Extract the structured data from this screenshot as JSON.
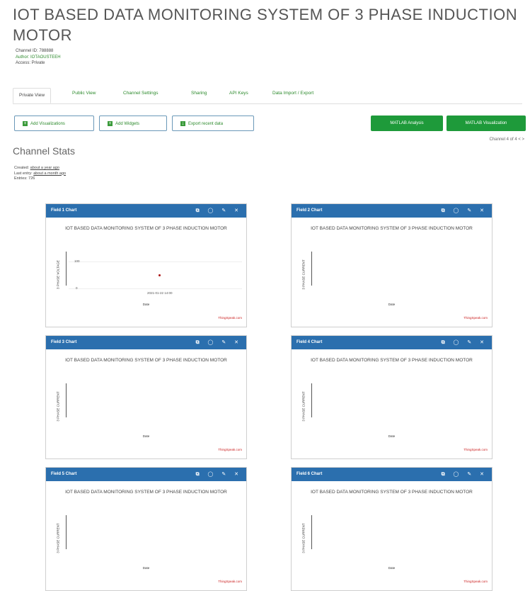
{
  "page": {
    "title": "IOT BASED DATA MONITORING SYSTEM OF 3 PHASE INDUCTION MOTOR"
  },
  "meta": {
    "channel_id": "Channel ID: 788888",
    "author": "Author: IOTAOUSTEEH",
    "access": "Access: Private"
  },
  "tabs": [
    {
      "label": "Private View"
    },
    {
      "label": "Public View"
    },
    {
      "label": "Channel Settings"
    },
    {
      "label": "Sharing"
    },
    {
      "label": "API Keys"
    },
    {
      "label": "Data Import / Export"
    }
  ],
  "toolbar": {
    "add_visualizations": "Add Visualizations",
    "add_widgets": "Add Widgets",
    "export_recent_data": "Export recent data",
    "matlab_analysis": "MATLAB Analysis",
    "matlab_visualization": "MATLAB Visualization"
  },
  "pager": "Channel 4 of 4 < >",
  "stats": {
    "title": "Channel Stats",
    "created": "Created:",
    "created_value": "about a year ago",
    "last_entry": "Last entry:",
    "last_entry_value": "about a month ago",
    "entries": "Entries: 726"
  },
  "chart_title": "IOT BASED DATA MONITORING SYSTEM OF 3 PHASE INDUCTION MOTOR",
  "chart_credit": "ThingSpeak.com",
  "chart_xlabel": "Date",
  "header_icons": "⧉ ◯ ✎ ✕",
  "charts": [
    {
      "header": "Field 1 Chart",
      "ylabel": "3 PHASE VOLTAGE",
      "has_point": true,
      "tick_top": "100",
      "tick_bottom": "0",
      "date_label": "2021-01-22 14:00"
    },
    {
      "header": "Field 2 Chart",
      "ylabel": "3 PHASE CURRENT",
      "has_point": false
    },
    {
      "header": "Field 3 Chart",
      "ylabel": "3 PHASE CURRENT",
      "has_point": false
    },
    {
      "header": "Field 4 Chart",
      "ylabel": "3 PHASE CURRENT",
      "has_point": false
    },
    {
      "header": "Field 5 Chart",
      "ylabel": "3 PHASE CURRENT",
      "has_point": false
    },
    {
      "header": "Field 6 Chart",
      "ylabel": "3 PHASE CURRENT",
      "has_point": false
    }
  ],
  "chart_data": [
    {
      "type": "scatter",
      "title": "IOT BASED DATA MONITORING SYSTEM OF 3 PHASE INDUCTION MOTOR",
      "xlabel": "Date",
      "ylabel": "3 PHASE VOLTAGE",
      "ylim": [
        0,
        100
      ],
      "points": [
        {
          "x": "2021-01-22 14:00",
          "y": 50
        }
      ]
    },
    {
      "type": "scatter",
      "title": "IOT BASED DATA MONITORING SYSTEM OF 3 PHASE INDUCTION MOTOR",
      "xlabel": "Date",
      "ylabel": "3 PHASE CURRENT",
      "points": []
    },
    {
      "type": "scatter",
      "title": "IOT BASED DATA MONITORING SYSTEM OF 3 PHASE INDUCTION MOTOR",
      "xlabel": "Date",
      "ylabel": "3 PHASE CURRENT",
      "points": []
    },
    {
      "type": "scatter",
      "title": "IOT BASED DATA MONITORING SYSTEM OF 3 PHASE INDUCTION MOTOR",
      "xlabel": "Date",
      "ylabel": "3 PHASE CURRENT",
      "points": []
    },
    {
      "type": "scatter",
      "title": "IOT BASED DATA MONITORING SYSTEM OF 3 PHASE INDUCTION MOTOR",
      "xlabel": "Date",
      "ylabel": "3 PHASE CURRENT",
      "points": []
    },
    {
      "type": "scatter",
      "title": "IOT BASED DATA MONITORING SYSTEM OF 3 PHASE INDUCTION MOTOR",
      "xlabel": "Date",
      "ylabel": "3 PHASE CURRENT",
      "points": []
    }
  ]
}
